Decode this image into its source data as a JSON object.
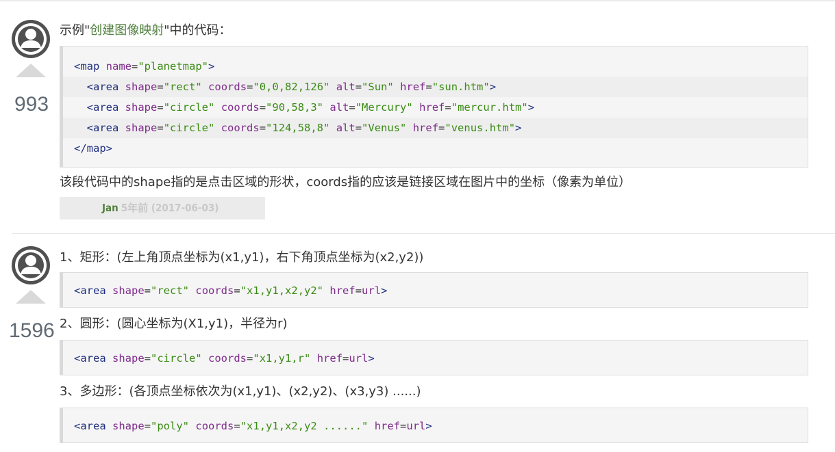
{
  "notes": [
    {
      "votes": "993",
      "intro_prefix": "示例\"",
      "intro_link": "创建图像映射",
      "intro_suffix": "\"中的代码：",
      "code_lines": [
        {
          "indent": "",
          "parts": [
            {
              "t": "<map ",
              "c": "tg"
            },
            {
              "t": "name",
              "c": "at"
            },
            {
              "t": "=",
              "c": "ps"
            },
            {
              "t": "\"planetmap\"",
              "c": "st"
            },
            {
              "t": ">",
              "c": "tg"
            }
          ]
        },
        {
          "indent": "  ",
          "parts": [
            {
              "t": "<area ",
              "c": "tg"
            },
            {
              "t": "shape",
              "c": "at"
            },
            {
              "t": "=",
              "c": "ps"
            },
            {
              "t": "\"rect\"",
              "c": "st"
            },
            {
              "t": " ",
              "c": "ps"
            },
            {
              "t": "coords",
              "c": "at"
            },
            {
              "t": "=",
              "c": "ps"
            },
            {
              "t": "\"0,0,82,126\"",
              "c": "st"
            },
            {
              "t": " ",
              "c": "ps"
            },
            {
              "t": "alt",
              "c": "at"
            },
            {
              "t": "=",
              "c": "ps"
            },
            {
              "t": "\"Sun\"",
              "c": "st"
            },
            {
              "t": " ",
              "c": "ps"
            },
            {
              "t": "href",
              "c": "at"
            },
            {
              "t": "=",
              "c": "ps"
            },
            {
              "t": "\"sun.htm\"",
              "c": "st"
            },
            {
              "t": ">",
              "c": "tg"
            }
          ]
        },
        {
          "indent": "  ",
          "parts": [
            {
              "t": "<area ",
              "c": "tg"
            },
            {
              "t": "shape",
              "c": "at"
            },
            {
              "t": "=",
              "c": "ps"
            },
            {
              "t": "\"circle\"",
              "c": "st"
            },
            {
              "t": " ",
              "c": "ps"
            },
            {
              "t": "coords",
              "c": "at"
            },
            {
              "t": "=",
              "c": "ps"
            },
            {
              "t": "\"90,58,3\"",
              "c": "st"
            },
            {
              "t": " ",
              "c": "ps"
            },
            {
              "t": "alt",
              "c": "at"
            },
            {
              "t": "=",
              "c": "ps"
            },
            {
              "t": "\"Mercury\"",
              "c": "st"
            },
            {
              "t": " ",
              "c": "ps"
            },
            {
              "t": "href",
              "c": "at"
            },
            {
              "t": "=",
              "c": "ps"
            },
            {
              "t": "\"mercur.htm\"",
              "c": "st"
            },
            {
              "t": ">",
              "c": "tg"
            }
          ]
        },
        {
          "indent": "  ",
          "parts": [
            {
              "t": "<area ",
              "c": "tg"
            },
            {
              "t": "shape",
              "c": "at"
            },
            {
              "t": "=",
              "c": "ps"
            },
            {
              "t": "\"circle\"",
              "c": "st"
            },
            {
              "t": " ",
              "c": "ps"
            },
            {
              "t": "coords",
              "c": "at"
            },
            {
              "t": "=",
              "c": "ps"
            },
            {
              "t": "\"124,58,8\"",
              "c": "st"
            },
            {
              "t": " ",
              "c": "ps"
            },
            {
              "t": "alt",
              "c": "at"
            },
            {
              "t": "=",
              "c": "ps"
            },
            {
              "t": "\"Venus\"",
              "c": "st"
            },
            {
              "t": " ",
              "c": "ps"
            },
            {
              "t": "href",
              "c": "at"
            },
            {
              "t": "=",
              "c": "ps"
            },
            {
              "t": "\"venus.htm\"",
              "c": "st"
            },
            {
              "t": ">",
              "c": "tg"
            }
          ]
        },
        {
          "indent": "",
          "parts": [
            {
              "t": "</map>",
              "c": "tg"
            }
          ]
        }
      ],
      "explanation": "该段代码中的shape指的是点击区域的形状，coords指的应该是链接区域在图片中的坐标（像素为单位）",
      "author": "Jan",
      "time": "5年前 (2017-06-03)"
    },
    {
      "votes": "1596",
      "items": [
        {
          "text": "1、矩形：(左上角顶点坐标为(x1,y1)，右下角顶点坐标为(x2,y2))",
          "code": [
            {
              "t": "<area ",
              "c": "tg"
            },
            {
              "t": "shape",
              "c": "at"
            },
            {
              "t": "=",
              "c": "ps"
            },
            {
              "t": "\"rect\"",
              "c": "st"
            },
            {
              "t": " ",
              "c": "ps"
            },
            {
              "t": "coords",
              "c": "at"
            },
            {
              "t": "=",
              "c": "ps"
            },
            {
              "t": "\"x1,y1,x2,y2\"",
              "c": "st"
            },
            {
              "t": " ",
              "c": "ps"
            },
            {
              "t": "href",
              "c": "at"
            },
            {
              "t": "=",
              "c": "ps"
            },
            {
              "t": "url",
              "c": "at"
            },
            {
              "t": ">",
              "c": "tg"
            }
          ]
        },
        {
          "text": "2、圆形：(圆心坐标为(X1,y1)，半径为r)",
          "code": [
            {
              "t": "<area ",
              "c": "tg"
            },
            {
              "t": "shape",
              "c": "at"
            },
            {
              "t": "=",
              "c": "ps"
            },
            {
              "t": "\"circle\"",
              "c": "st"
            },
            {
              "t": " ",
              "c": "ps"
            },
            {
              "t": "coords",
              "c": "at"
            },
            {
              "t": "=",
              "c": "ps"
            },
            {
              "t": "\"x1,y1,r\"",
              "c": "st"
            },
            {
              "t": " ",
              "c": "ps"
            },
            {
              "t": "href",
              "c": "at"
            },
            {
              "t": "=",
              "c": "ps"
            },
            {
              "t": "url",
              "c": "at"
            },
            {
              "t": ">",
              "c": "tg"
            }
          ]
        },
        {
          "text": "3、多边形：(各顶点坐标依次为(x1,y1)、(x2,y2)、(x3,y3) ......)",
          "code": [
            {
              "t": "<area ",
              "c": "tg"
            },
            {
              "t": "shape",
              "c": "at"
            },
            {
              "t": "=",
              "c": "ps"
            },
            {
              "t": "\"poly\"",
              "c": "st"
            },
            {
              "t": " ",
              "c": "ps"
            },
            {
              "t": "coords",
              "c": "at"
            },
            {
              "t": "=",
              "c": "ps"
            },
            {
              "t": "\"x1,y1,x2,y2 ......\"",
              "c": "st"
            },
            {
              "t": " ",
              "c": "ps"
            },
            {
              "t": "href",
              "c": "at"
            },
            {
              "t": "=",
              "c": "ps"
            },
            {
              "t": "url",
              "c": "at"
            },
            {
              "t": ">",
              "c": "tg"
            }
          ]
        }
      ]
    }
  ],
  "colors": {
    "link_green": "#50813e",
    "code_tag": "#1f2f7f",
    "code_attr": "#7e2a8b",
    "code_string": "#3a8b13",
    "vote_gray": "#d9d9d9"
  },
  "icons": {
    "avatar": "user-avatar-icon",
    "vote": "upvote-triangle-icon"
  }
}
